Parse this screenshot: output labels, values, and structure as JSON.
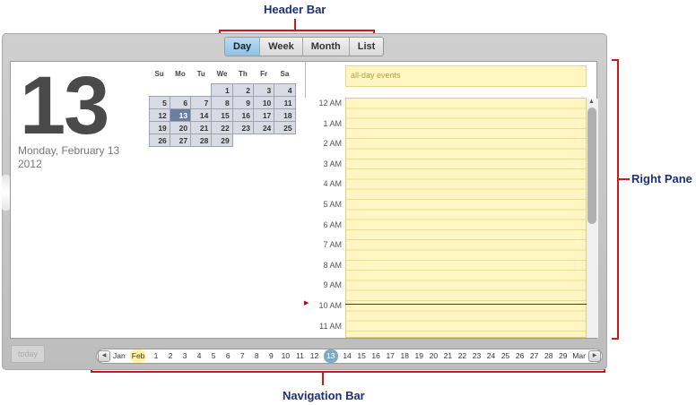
{
  "annotations": {
    "header_bar": "Header Bar",
    "right_pane": "Right Pane",
    "navigation_bar": "Navigation Bar"
  },
  "header": {
    "views": [
      {
        "label": "Day",
        "active": true
      },
      {
        "label": "Week"
      },
      {
        "label": "Month"
      },
      {
        "label": "List"
      }
    ]
  },
  "left_pane": {
    "day_number": "13",
    "date_text": "Monday, February 13",
    "year_text": "2012",
    "mini_calendar": {
      "weekdays": [
        "Su",
        "Mo",
        "Tu",
        "We",
        "Th",
        "Fr",
        "Sa"
      ],
      "days": [
        "",
        "",
        "",
        "1",
        "2",
        "3",
        "4",
        "5",
        "6",
        "7",
        "8",
        "9",
        "10",
        "11",
        "12",
        "13",
        "14",
        "15",
        "16",
        "17",
        "18",
        "19",
        "20",
        "21",
        "22",
        "23",
        "24",
        "25",
        "26",
        "27",
        "28",
        "29",
        "",
        "",
        ""
      ],
      "selected": "13"
    }
  },
  "right_pane": {
    "all_day_label": "all-day events",
    "hours": [
      "12 AM",
      "1 AM",
      "2 AM",
      "3 AM",
      "4 AM",
      "5 AM",
      "6 AM",
      "7 AM",
      "8 AM",
      "9 AM",
      "10 AM",
      "11 AM"
    ]
  },
  "footer": {
    "today_label": "today"
  },
  "navigation": {
    "items": [
      "Jan",
      "Feb",
      "1",
      "2",
      "3",
      "4",
      "5",
      "6",
      "7",
      "8",
      "9",
      "10",
      "11",
      "12",
      "13",
      "14",
      "15",
      "16",
      "17",
      "18",
      "19",
      "20",
      "21",
      "22",
      "23",
      "24",
      "25",
      "26",
      "27",
      "28",
      "29",
      "Mar"
    ],
    "current_month": "Feb",
    "selected_day": "13"
  }
}
